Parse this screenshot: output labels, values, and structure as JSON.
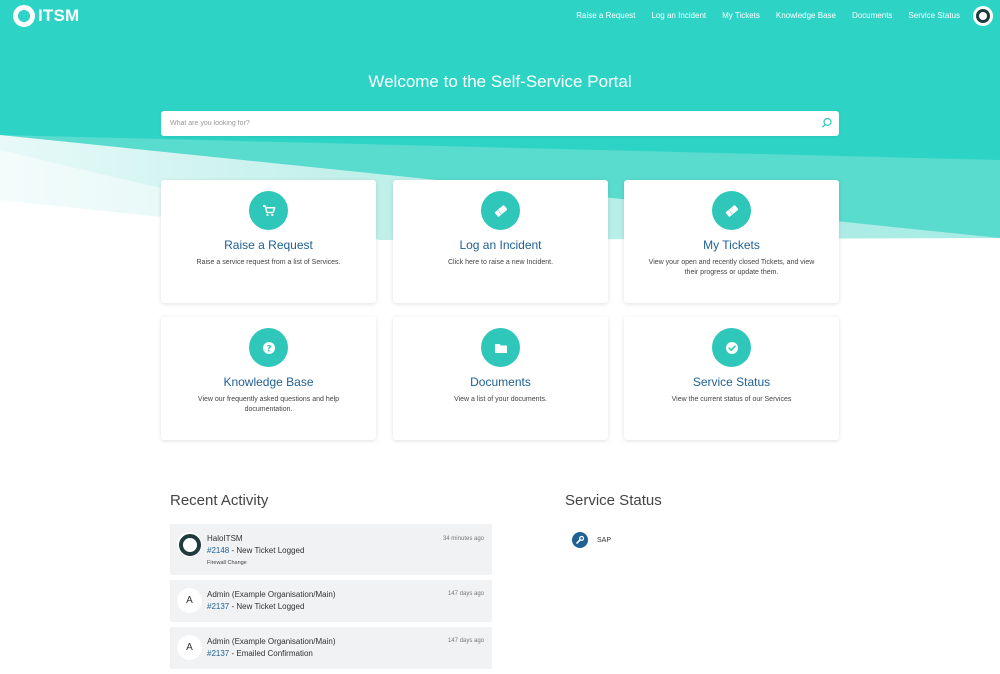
{
  "header": {
    "logo_text": "ITSM",
    "nav": [
      "Raise a Request",
      "Log an Incident",
      "My Tickets",
      "Knowledge Base",
      "Documents",
      "Service Status"
    ]
  },
  "hero": {
    "title": "Welcome to the Self-Service Portal",
    "search_placeholder": "What are you looking for?"
  },
  "cards": [
    {
      "title": "Raise a Request",
      "desc": "Raise a service request from a list of Services.",
      "icon": "cart-icon"
    },
    {
      "title": "Log an Incident",
      "desc": "Click here to raise a new Incident.",
      "icon": "ticket-icon"
    },
    {
      "title": "My Tickets",
      "desc": "View your open and recently closed Tickets, and view their progress or update them.",
      "icon": "ticket-icon"
    },
    {
      "title": "Knowledge Base",
      "desc": "View our frequently asked questions and help documentation.",
      "icon": "question-icon"
    },
    {
      "title": "Documents",
      "desc": "View a list of your documents.",
      "icon": "folder-icon"
    },
    {
      "title": "Service Status",
      "desc": "View the current status of our Services",
      "icon": "check-icon"
    }
  ],
  "recent_activity": {
    "title": "Recent Activity",
    "items": [
      {
        "avatar": "",
        "name": "HaloITSM",
        "time": "34 minutes ago",
        "ticket": "#2148",
        "action": " - New Ticket Logged",
        "detail": "Firewall Change"
      },
      {
        "avatar": "A",
        "name": "Admin (Example Organisation/Main)",
        "time": "147 days ago",
        "ticket": "#2137",
        "action": " - New Ticket Logged",
        "detail": ""
      },
      {
        "avatar": "A",
        "name": "Admin (Example Organisation/Main)",
        "time": "147 days ago",
        "ticket": "#2137",
        "action": " - Emailed Confirmation",
        "detail": ""
      }
    ]
  },
  "service_status": {
    "title": "Service Status",
    "services": [
      {
        "name": "SAP",
        "icon": "wrench-icon"
      }
    ]
  },
  "colors": {
    "teal": "#2dd4c6",
    "teal_light": "#b9efea",
    "accent_circle": "#2ec7b9",
    "title_blue": "#1f6195"
  }
}
